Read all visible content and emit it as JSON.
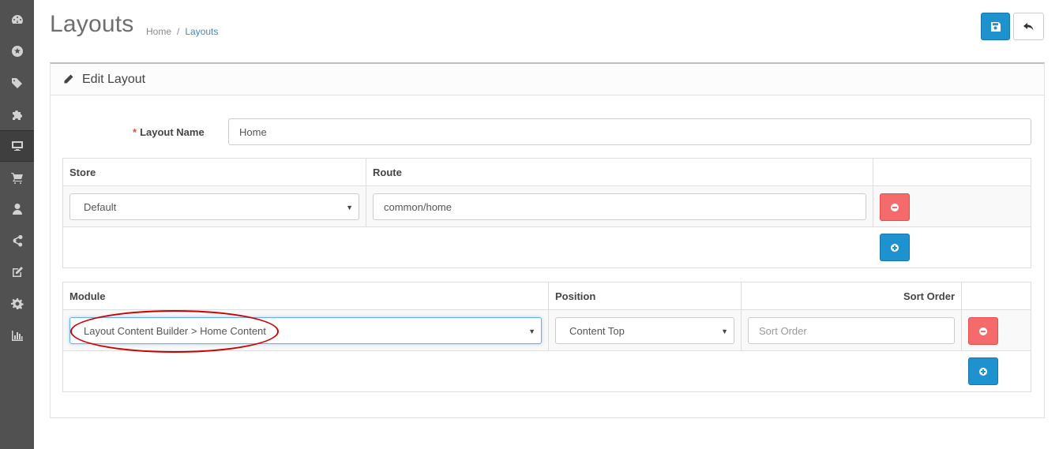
{
  "sidebar": {
    "items": [
      {
        "icon": "dashboard-icon"
      },
      {
        "icon": "catalog-icon"
      },
      {
        "icon": "tags-icon"
      },
      {
        "icon": "extensions-icon"
      },
      {
        "icon": "design-icon",
        "active": true
      },
      {
        "icon": "cart-icon"
      },
      {
        "icon": "customer-icon"
      },
      {
        "icon": "share-icon"
      },
      {
        "icon": "edit-icon"
      },
      {
        "icon": "settings-icon"
      },
      {
        "icon": "reports-icon"
      }
    ]
  },
  "header": {
    "title": "Layouts",
    "breadcrumb": {
      "home": "Home",
      "separator": "/",
      "current": "Layouts"
    }
  },
  "panel": {
    "title": "Edit Layout"
  },
  "form": {
    "layout_name_required": "*",
    "layout_name_label": "Layout Name",
    "layout_name_value": "Home"
  },
  "routes_table": {
    "headers": {
      "store": "Store",
      "route": "Route"
    },
    "rows": [
      {
        "store": "Default",
        "route": "common/home"
      }
    ]
  },
  "modules_table": {
    "headers": {
      "module": "Module",
      "position": "Position",
      "sort_order": "Sort Order"
    },
    "rows": [
      {
        "module": "Layout Content Builder > Home Content",
        "position": "Content Top",
        "sort_order_placeholder": "Sort Order"
      }
    ]
  },
  "colors": {
    "sidebar": "#515151",
    "primary": "#1e91cf",
    "danger": "#f56b6b",
    "annotation": "#cc0000"
  }
}
